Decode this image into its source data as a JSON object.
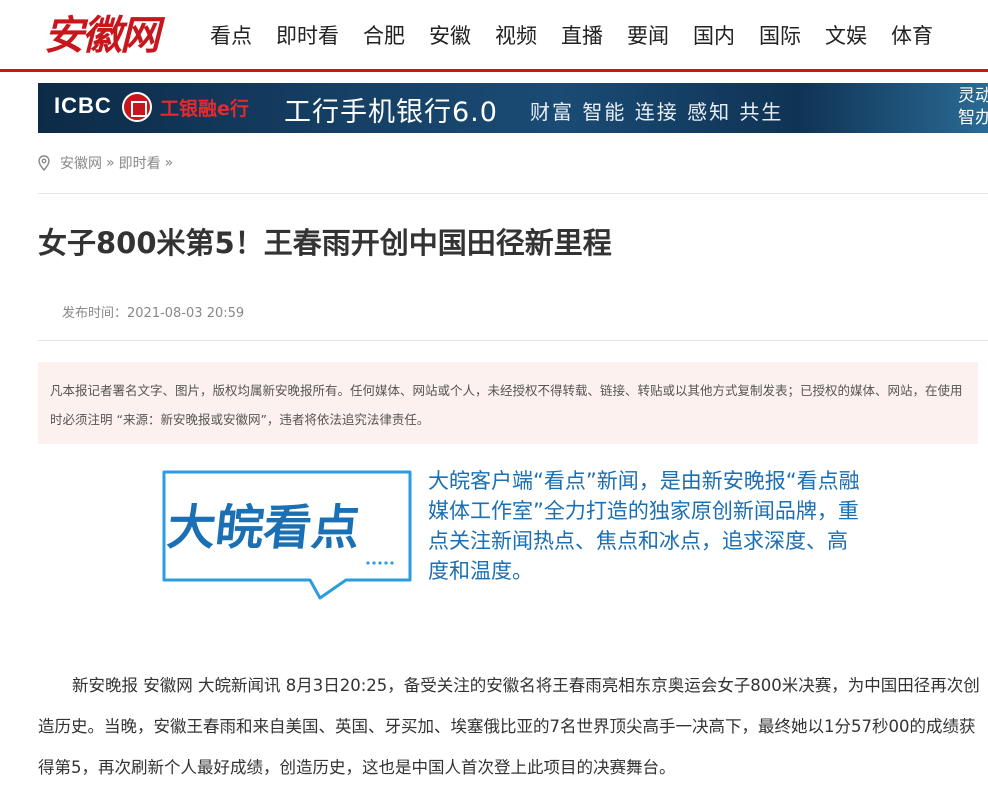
{
  "header": {
    "logo_text": "安徽网",
    "nav": [
      "看点",
      "即时看",
      "合肥",
      "安徽",
      "视频",
      "直播",
      "要闻",
      "国内",
      "国际",
      "文娱",
      "体育"
    ]
  },
  "banner": {
    "brand": "ICBC",
    "bank_name": "工银融e行",
    "main_text": "工行手机银行6.0",
    "slogan": "财富 智能 连接 感知 共生",
    "right_text": "灵动 智办"
  },
  "breadcrumb": {
    "items": [
      "安徽网",
      "即时看"
    ],
    "separator": "»"
  },
  "article": {
    "title": "女子800米第5！王春雨开创中国田径新里程",
    "pubtime_label": "发布时间：",
    "pubtime": "2021-08-03 20:59",
    "notice": "凡本报记者署名文字、图片，版权均属新安晚报所有。任何媒体、网站或个人，未经授权不得转载、链接、转贴或以其他方式复制发表；已授权的媒体、网站，在使用时必须注明 “来源：新安晚报或安徽网”，违者将依法追究法律责任。",
    "promo_logo_text": "大皖看点",
    "promo_text": "大皖客户端“看点”新闻，是由新安晚报“看点融媒体工作室”全力打造的独家原创新闻品牌，重点关注新闻热点、焦点和冰点，追求深度、高度和温度。",
    "paragraph": "新安晚报  安徽网  大皖新闻讯  8月3日20:25，备受关注的安徽名将王春雨亮相东京奥运会女子800米决赛，为中国田径再次创造历史。当晚，安徽王春雨和来自美国、英国、牙买加、埃塞俄比亚的7名世界顶尖高手一决高下，最终她以1分57秒00的成绩获得第5，再次刷新个人最好成绩，创造历史，这也是中国人首次登上此项目的决赛舞台。"
  },
  "colors": {
    "brand_red": "#c8161d",
    "promo_blue": "#1b6fb3",
    "notice_bg": "#fcf1ee"
  }
}
